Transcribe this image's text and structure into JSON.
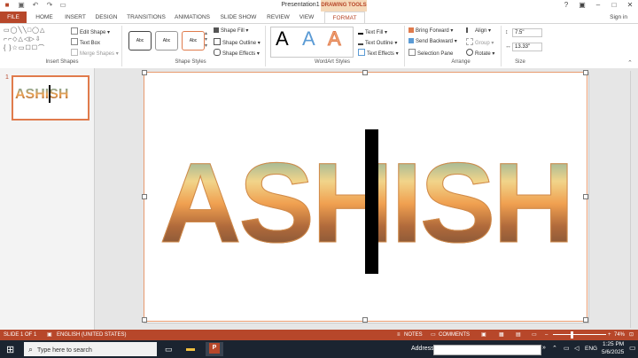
{
  "window": {
    "title": "Presentation1 - PowerPoint",
    "contextual_tab": "DRAWING TOOLS"
  },
  "tabs": [
    {
      "label": "FILE"
    },
    {
      "label": "HOME"
    },
    {
      "label": "INSERT"
    },
    {
      "label": "DESIGN"
    },
    {
      "label": "TRANSITIONS"
    },
    {
      "label": "ANIMATIONS"
    },
    {
      "label": "SLIDE SHOW"
    },
    {
      "label": "REVIEW"
    },
    {
      "label": "VIEW"
    },
    {
      "label": "FORMAT"
    }
  ],
  "signin": "Sign in",
  "ribbon": {
    "insert_shapes": {
      "label": "Insert Shapes",
      "edit_shape": "Edit Shape",
      "text_box": "Text Box",
      "merge_shapes": "Merge Shapes"
    },
    "shape_styles": {
      "label": "Shape Styles",
      "style_sample": "Abc",
      "shape_fill": "Shape Fill",
      "shape_outline": "Shape Outline",
      "shape_effects": "Shape Effects"
    },
    "wordart_styles": {
      "label": "WordArt Styles",
      "letter": "A",
      "text_fill": "Text Fill",
      "text_outline": "Text Outline",
      "text_effects": "Text Effects"
    },
    "arrange": {
      "label": "Arrange",
      "bring_forward": "Bring Forward",
      "send_backward": "Send Backward",
      "selection_pane": "Selection Pane",
      "align": "Align",
      "group": "Group",
      "rotate": "Rotate"
    },
    "size": {
      "label": "Size",
      "height": "7.5\"",
      "width": "13.33\""
    }
  },
  "thumbnail": {
    "number": "1",
    "text": "ASHISH"
  },
  "slide": {
    "text": "ASHISH"
  },
  "status": {
    "slide": "SLIDE 1 OF 1",
    "language": "ENGLISH (UNITED STATES)",
    "notes": "NOTES",
    "comments": "COMMENTS",
    "zoom": "74%"
  },
  "taskbar": {
    "search_placeholder": "Type here to search",
    "address_label": "Address",
    "language": "ENG",
    "time": "1:25 PM",
    "date": "5/6/2025"
  },
  "colors": {
    "accent": "#b7472a",
    "contextual": "#f5d8b8",
    "taskbar": "#1b2430"
  }
}
